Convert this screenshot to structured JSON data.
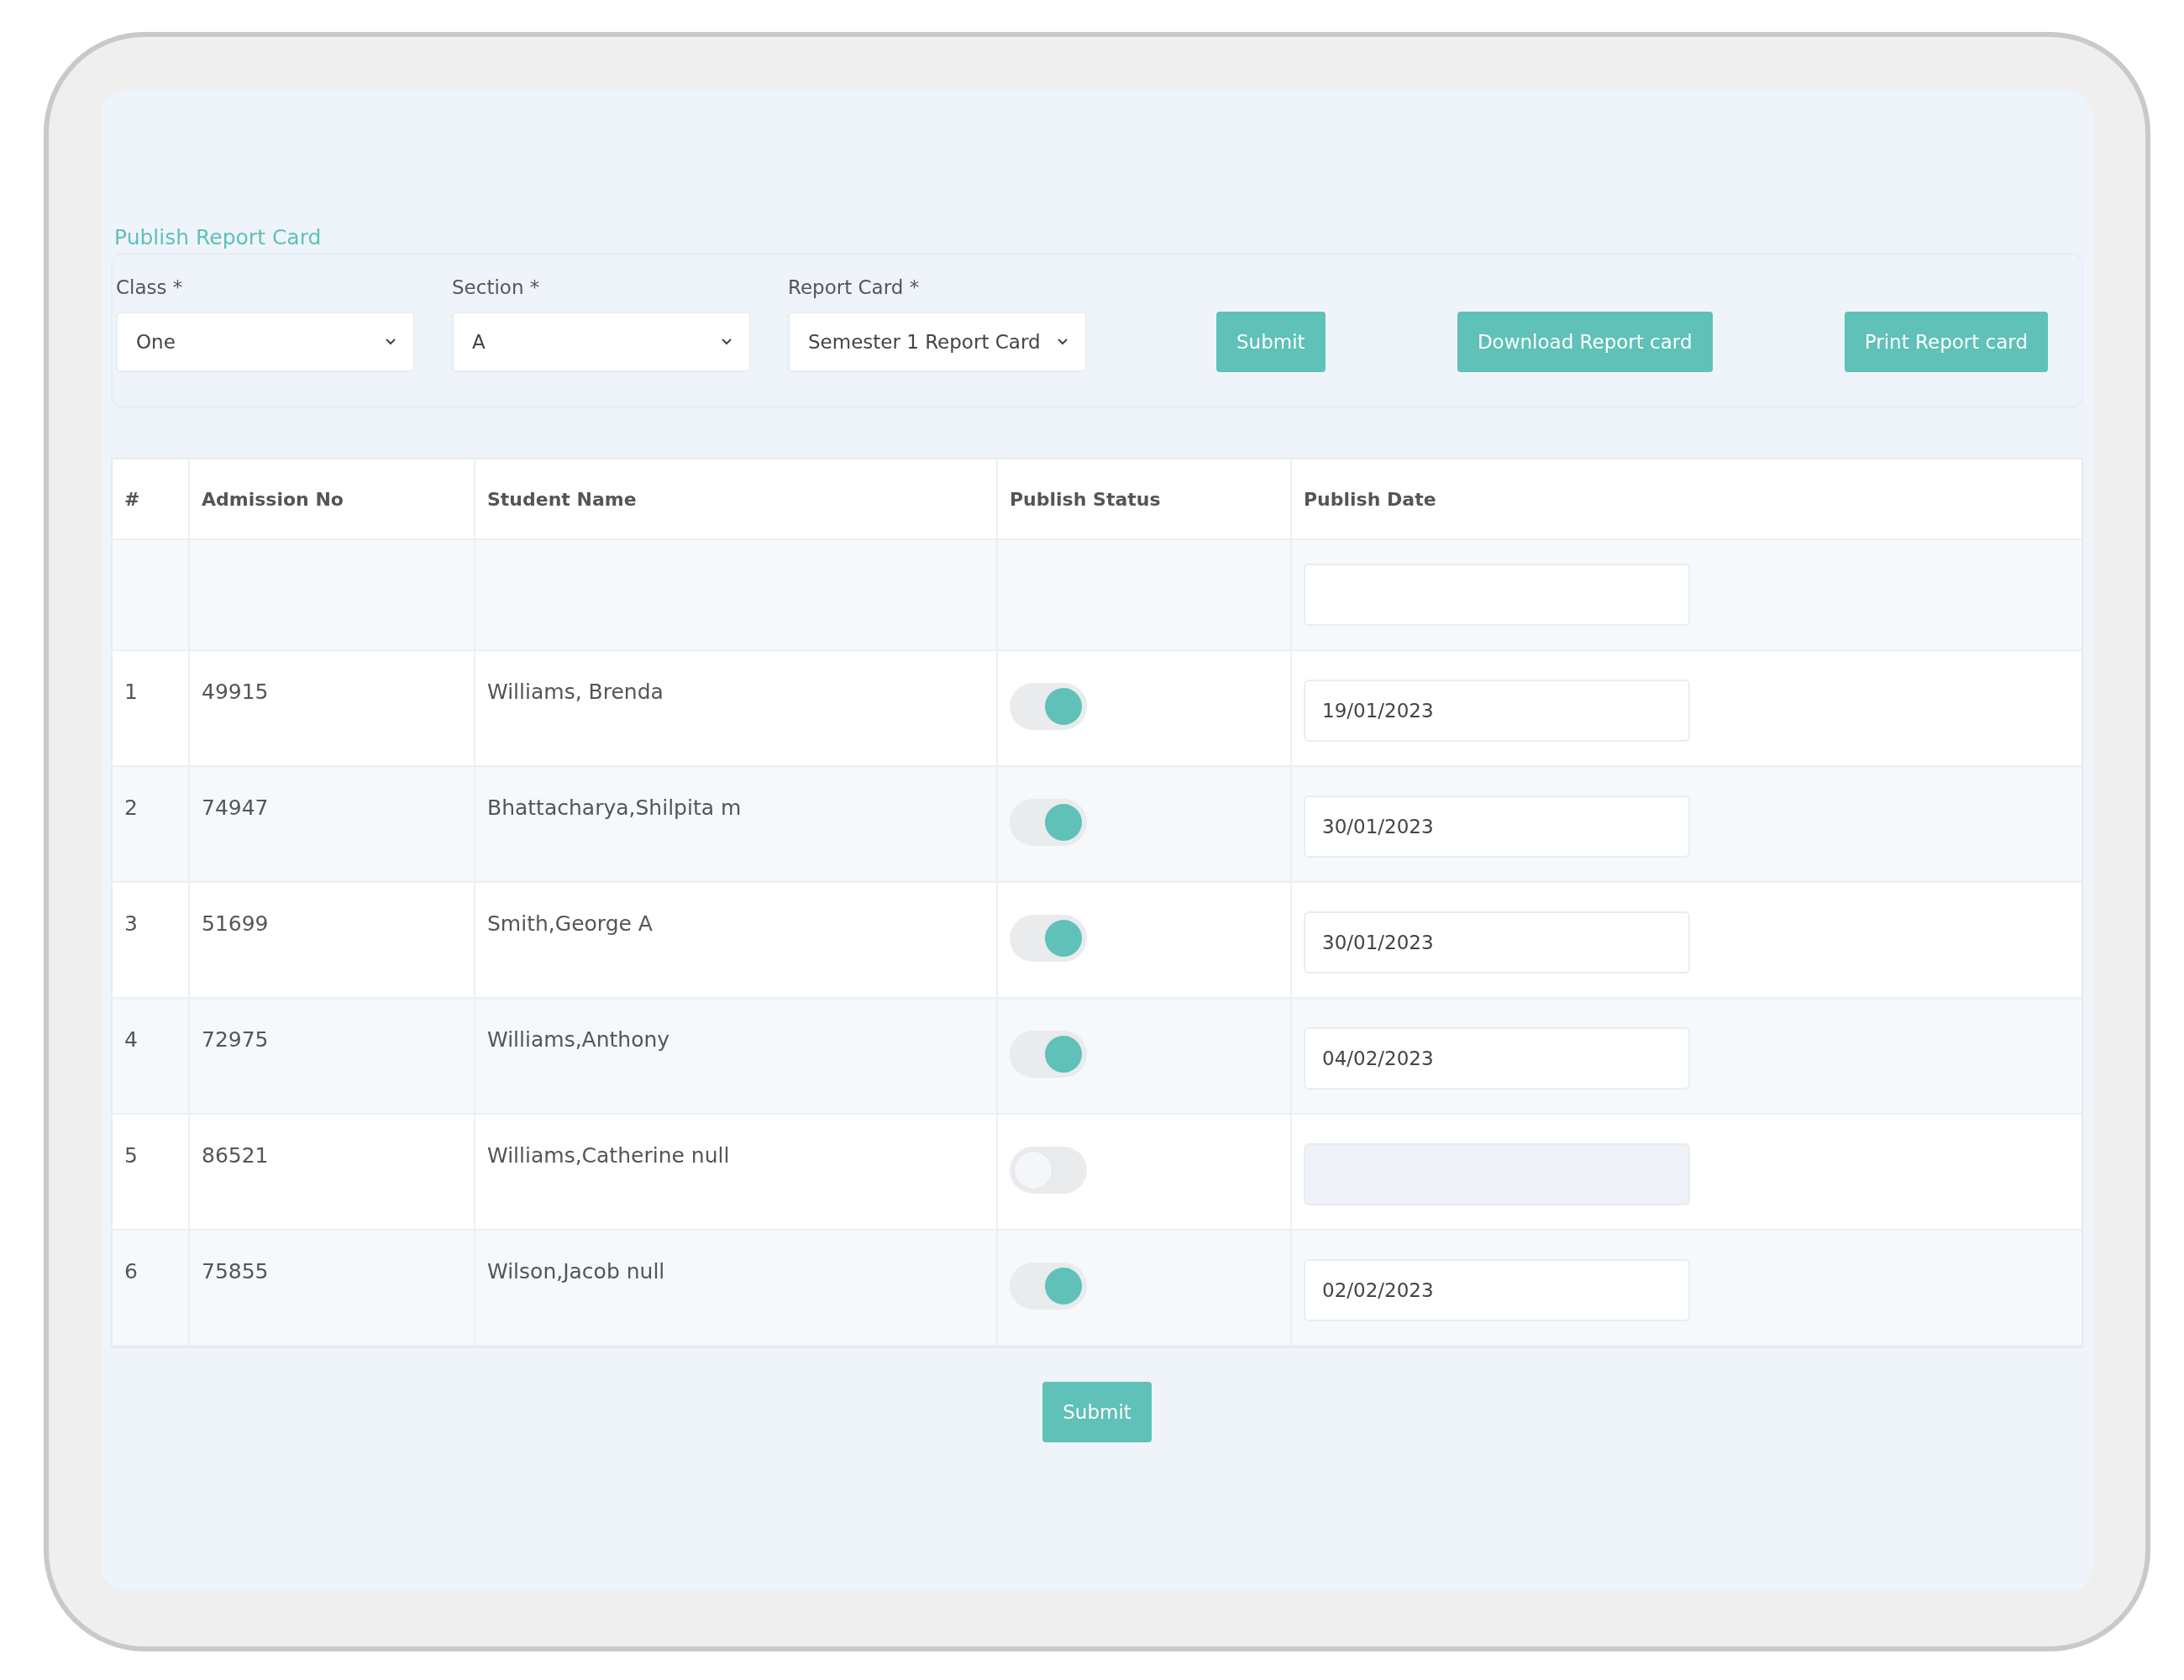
{
  "title": "Publish Report Card",
  "filters": [
    {
      "label": "Class *",
      "value": "One"
    },
    {
      "label": "Section *",
      "value": "A"
    },
    {
      "label": "Report Card *",
      "value": "Semester 1 Report Card"
    }
  ],
  "buttons": [
    "Submit",
    "Download Report card",
    "Print Report card"
  ],
  "table": {
    "columns": [
      "#",
      "Admission No",
      "Student Name",
      "Publish Status",
      "Publish Date"
    ],
    "rows": [
      {
        "index": "1",
        "admission_no": "49915",
        "name": "Williams, Brenda",
        "published": true,
        "publish_date": "19/01/2023"
      },
      {
        "index": "2",
        "admission_no": "74947",
        "name": "Bhattacharya,Shilpita m",
        "published": true,
        "publish_date": "30/01/2023"
      },
      {
        "index": "3",
        "admission_no": "51699",
        "name": "Smith,George A",
        "published": true,
        "publish_date": "30/01/2023"
      },
      {
        "index": "4",
        "admission_no": "72975",
        "name": "Williams,Anthony",
        "published": true,
        "publish_date": "04/02/2023"
      },
      {
        "index": "5",
        "admission_no": "86521",
        "name": "Williams,Catherine null",
        "published": false
      },
      {
        "index": "6",
        "admission_no": "75855",
        "name": "Wilson,Jacob null",
        "published": true,
        "publish_date": "02/02/2023"
      }
    ]
  },
  "footer_button": "Submit"
}
